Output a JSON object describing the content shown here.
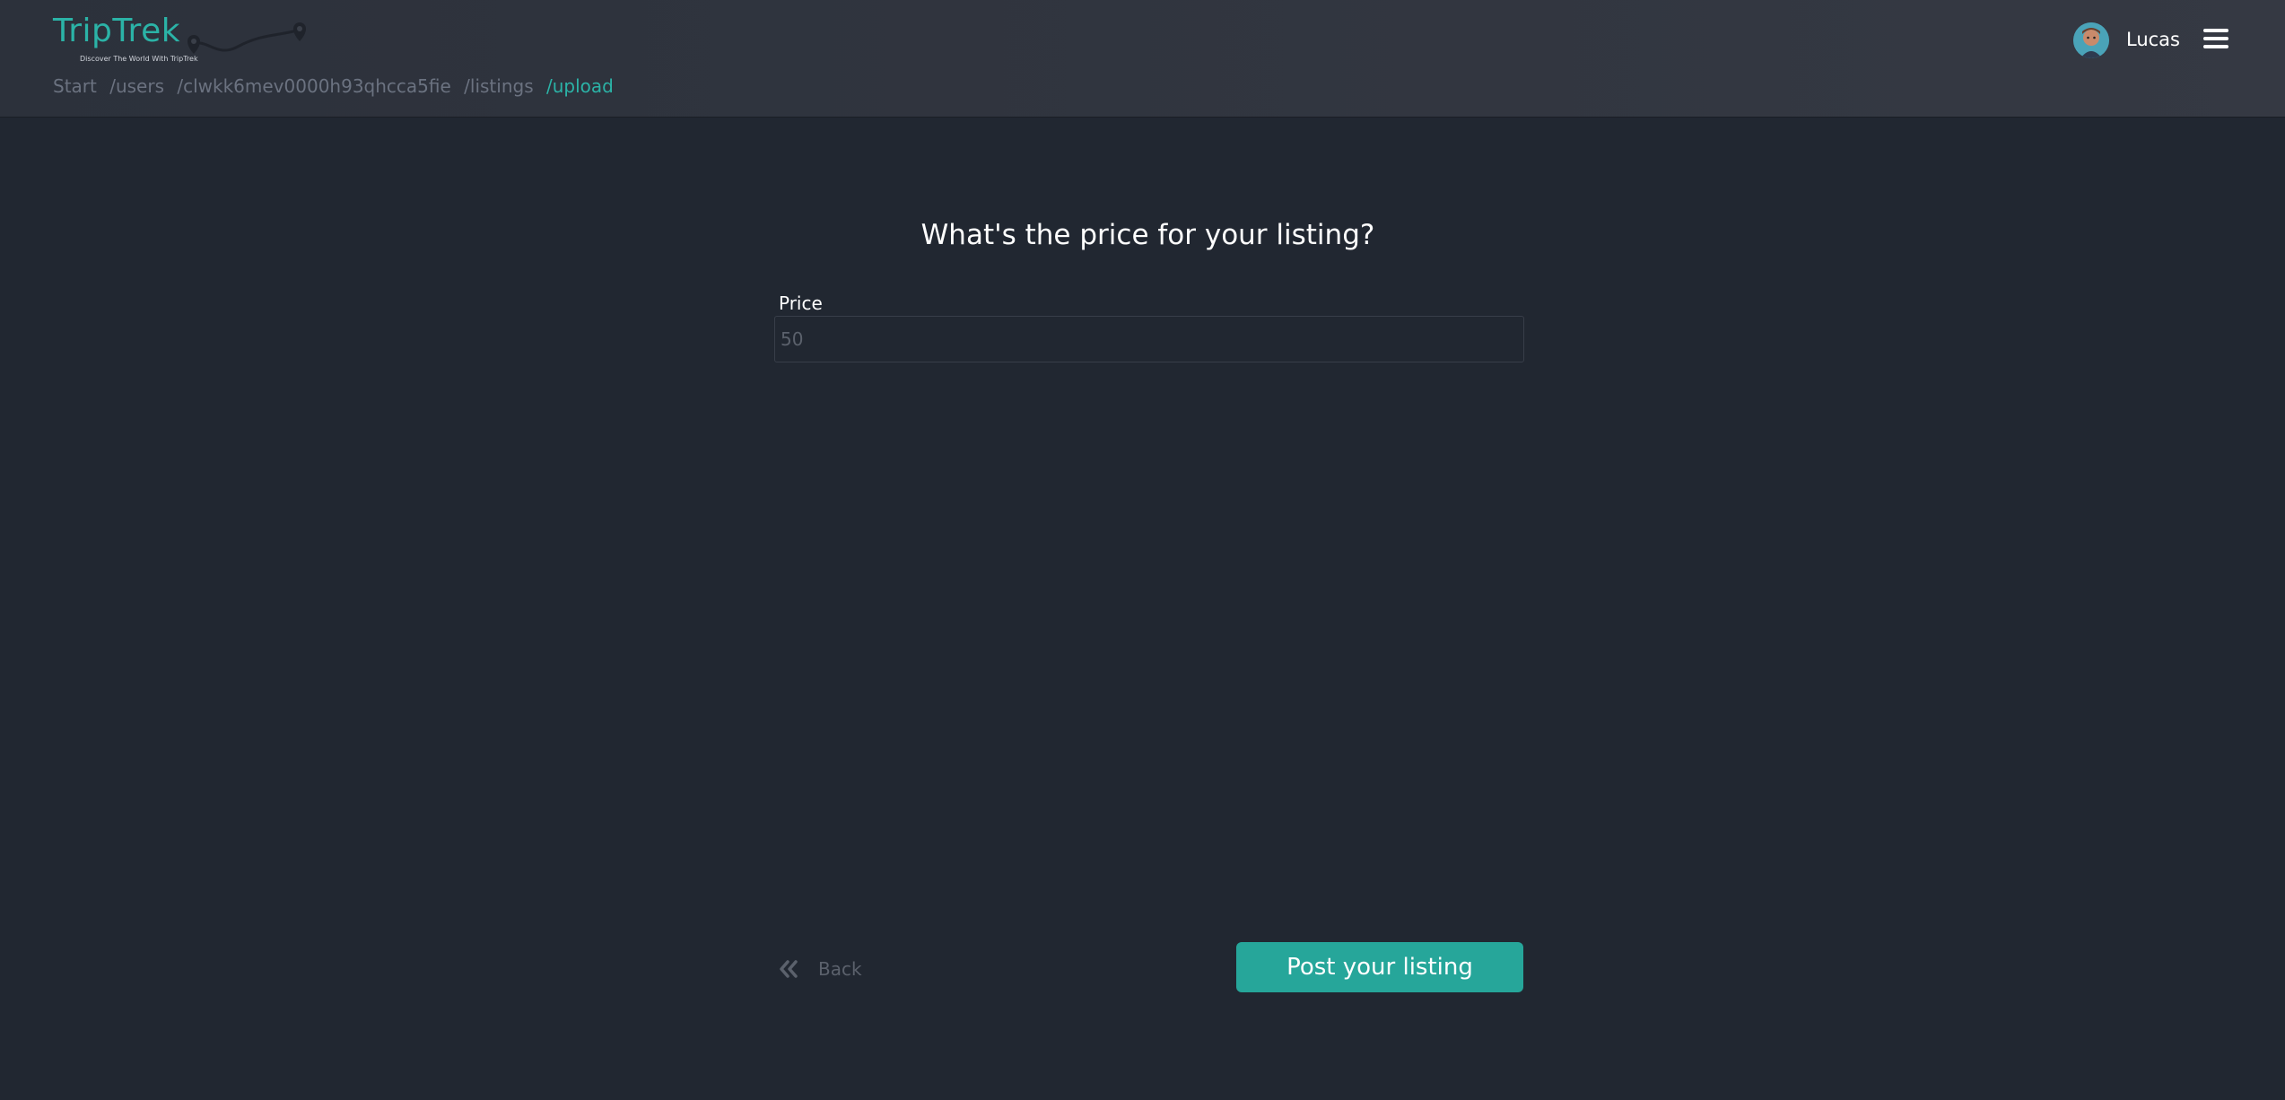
{
  "brand": {
    "name": "TripTrek",
    "tagline": "Discover The World With TripTrek",
    "accent_color": "#2bb3a7",
    "logo_icon": "route-map-pins-icon"
  },
  "breadcrumb": {
    "items": [
      "Start",
      "/users",
      "/clwkk6mev0000h93qhcca5fie",
      "/listings"
    ],
    "current": "/upload"
  },
  "user": {
    "name": "Lucas",
    "avatar_icon": "avatar-icon",
    "menu_icon": "hamburger-menu-icon"
  },
  "form": {
    "question": "What's the price for your listing?",
    "price_label": "Price",
    "price_placeholder": "50",
    "price_value": ""
  },
  "actions": {
    "back_label": "Back",
    "back_icon": "double-chevron-left-icon",
    "post_label": "Post your listing",
    "post_color": "#26a69a"
  }
}
